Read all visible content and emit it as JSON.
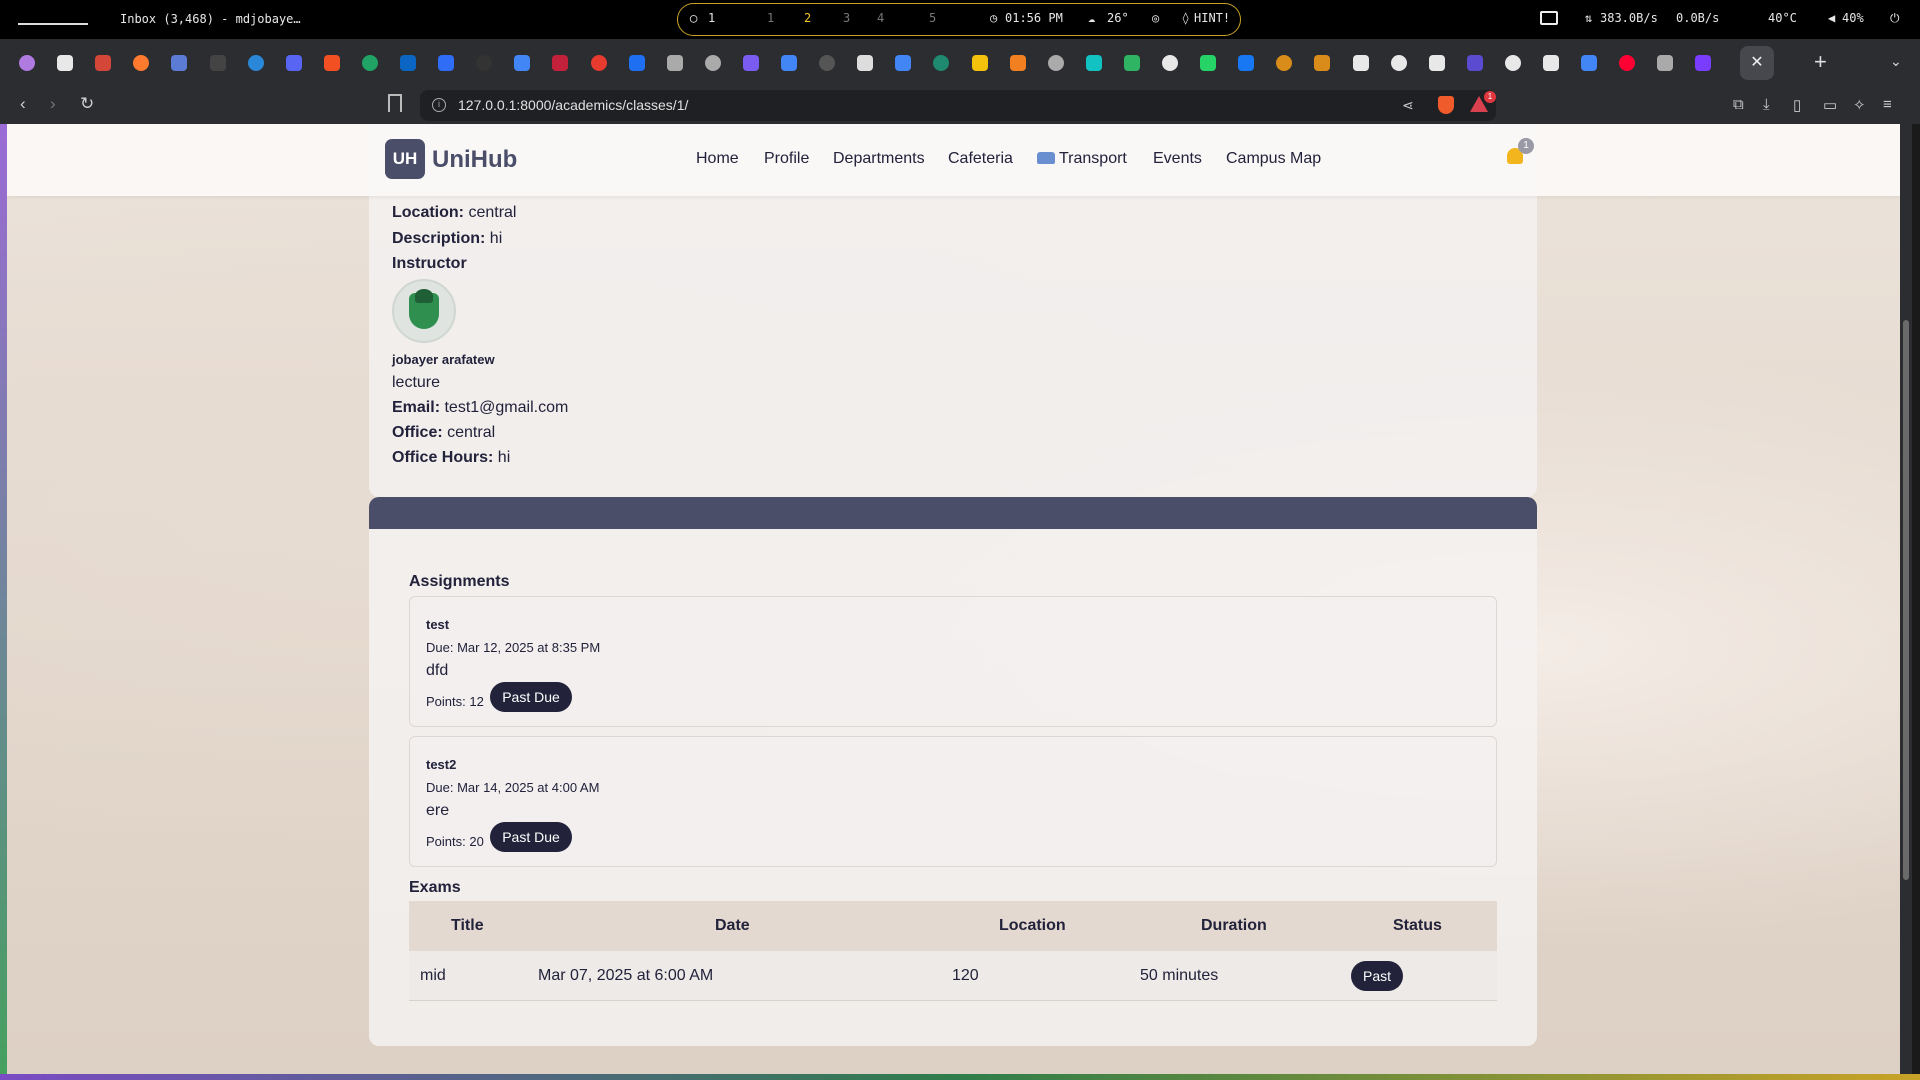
{
  "system_bar": {
    "window_title": "Inbox (3,468) - mdjobaye…",
    "workspaces": [
      "1",
      "1",
      "2",
      "3",
      "4",
      "5"
    ],
    "clock": "01:56 PM",
    "weather": "26°",
    "hint": "HINT!",
    "net_down": "383.0B/s",
    "net_up": "0.0B/s",
    "temp": "40°C",
    "volume": "40%"
  },
  "browser": {
    "url": "127.0.0.1:8000/academics/classes/1/",
    "rewards_count": "1",
    "tab_colors": [
      "#b07be0",
      "#e8e8e8",
      "#d44638",
      "#ff7a2f",
      "#5b7bd5",
      "#444",
      "#2b88d8",
      "#5865f2",
      "#f25022",
      "#21a366",
      "#0a66c2",
      "#2f6df6",
      "#333",
      "#4285f4",
      "#c3203b",
      "#e63b2e",
      "#1e6ff1",
      "#aaa",
      "#aaa",
      "#7a5cf0",
      "#4285f4",
      "#555",
      "#ddd",
      "#4285f4",
      "#1f8a6f",
      "#f4c20d",
      "#f38020",
      "#aaa",
      "#12c2c2",
      "#2fb463",
      "#e8e8e8",
      "#25d366",
      "#1877f2",
      "#d98c1a",
      "#d98c1a",
      "#e8e8e8",
      "#e8e8e8",
      "#e8e8e8",
      "#5a4bd1",
      "#e8e8e8",
      "#e8e8e8",
      "#4285f4",
      "#ff0033",
      "#aaa",
      "#7a3cff"
    ]
  },
  "site": {
    "logo_mark": "UH",
    "logo_text": "UniHub",
    "nav": [
      "Home",
      "Profile",
      "Departments",
      "Cafeteria",
      "Transport",
      "Events",
      "Campus Map"
    ],
    "notification_count": "1"
  },
  "class_info": {
    "location_label": "Location:",
    "location": "central",
    "description_label": "Description:",
    "description": "hi",
    "instructor_heading": "Instructor",
    "instructor_name": "jobayer arafatew",
    "instructor_title": "lecture",
    "email_label": "Email:",
    "email": "test1@gmail.com",
    "office_label": "Office:",
    "office": "central",
    "office_hours_label": "Office Hours:",
    "office_hours": "hi"
  },
  "assignments": {
    "heading": "Assignments",
    "items": [
      {
        "title": "test",
        "due": "Due: Mar 12, 2025 at 8:35 PM",
        "description": "dfd",
        "points": "Points: 12",
        "status": "Past Due"
      },
      {
        "title": "test2",
        "due": "Due: Mar 14, 2025 at 4:00 AM",
        "description": "ere",
        "points": "Points: 20",
        "status": "Past Due"
      }
    ]
  },
  "exams": {
    "heading": "Exams",
    "columns": [
      "Title",
      "Date",
      "Location",
      "Duration",
      "Status"
    ],
    "rows": [
      {
        "title": "mid",
        "date": "Mar 07, 2025 at 6:00 AM",
        "location": "120",
        "duration": "50 minutes",
        "status": "Past"
      }
    ]
  }
}
